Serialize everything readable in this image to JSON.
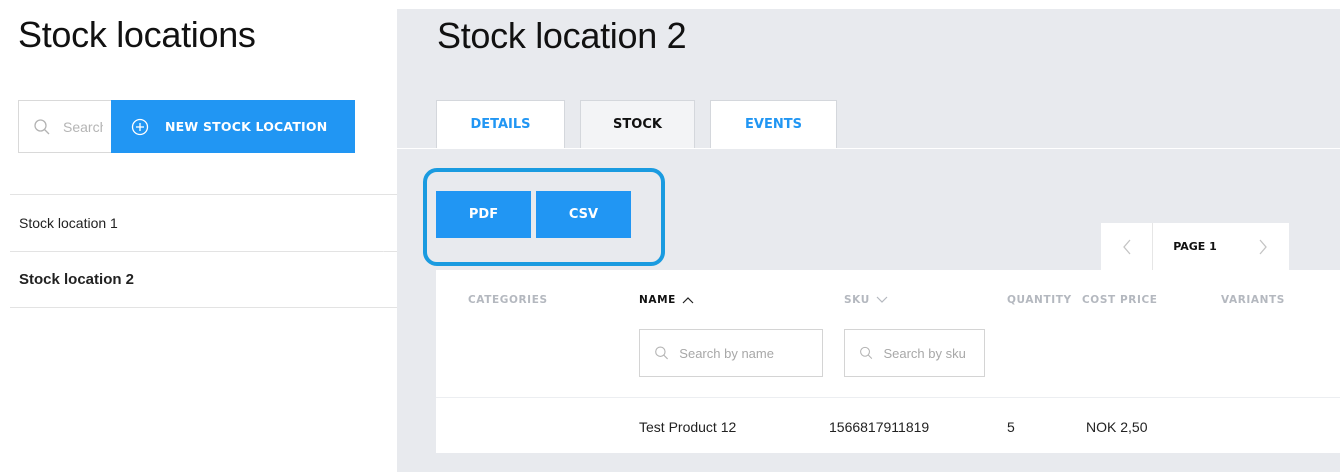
{
  "sidebar": {
    "title": "Stock locations",
    "search_placeholder": "Search",
    "new_button_label": "NEW STOCK LOCATION",
    "locations": [
      {
        "label": "Stock location 1",
        "active": false
      },
      {
        "label": "Stock location 2",
        "active": true
      }
    ]
  },
  "main": {
    "title": "Stock location 2",
    "tabs": [
      {
        "label": "DETAILS",
        "active": false
      },
      {
        "label": "STOCK",
        "active": true
      },
      {
        "label": "EVENTS",
        "active": false
      }
    ],
    "export": {
      "pdf_label": "PDF",
      "csv_label": "CSV"
    },
    "pagination": {
      "label": "PAGE 1"
    },
    "table": {
      "headers": [
        "CATEGORIES",
        "NAME",
        "SKU",
        "QUANTITY",
        "COST PRICE",
        "VARIANTS"
      ],
      "name_filter_placeholder": "Search by name",
      "sku_filter_placeholder": "Search by sku",
      "rows": [
        {
          "categories": "",
          "name": "Test Product 12",
          "sku": "1566817911819",
          "quantity": "5",
          "cost_price": "NOK 2,50",
          "variants": ""
        }
      ]
    }
  },
  "colors": {
    "accent": "#2196f3",
    "highlight_outline": "#1a9be0",
    "panel_bg": "#e8eaee",
    "muted_header": "#b4b8bf"
  },
  "icons": {
    "search": "search-icon",
    "add": "plus-circle-icon",
    "sort_asc": "chevron-up-icon",
    "sort_desc": "chevron-down-icon",
    "prev": "chevron-left-icon",
    "next": "chevron-right-icon"
  }
}
